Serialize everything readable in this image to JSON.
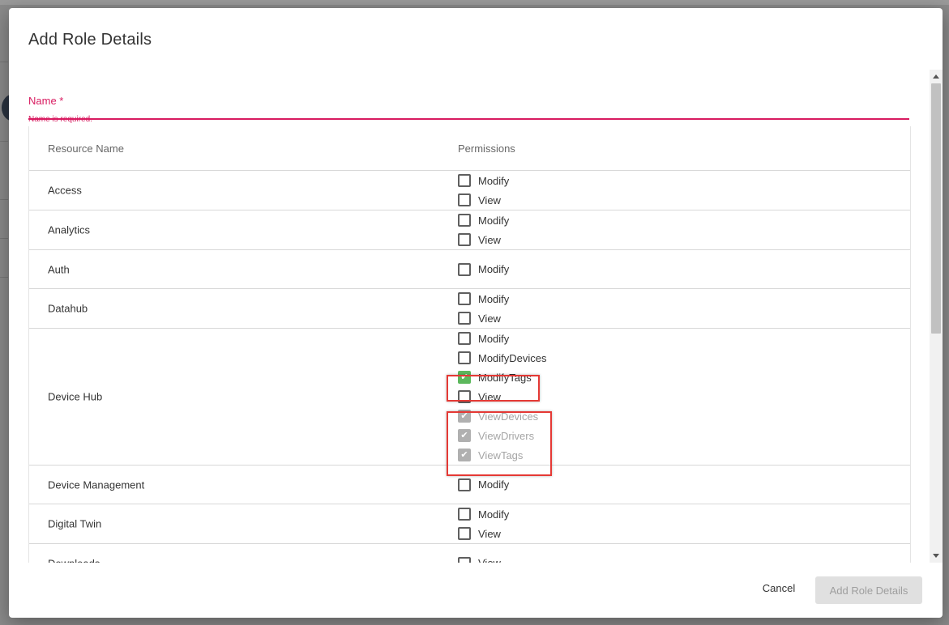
{
  "dialog": {
    "title": "Add Role Details",
    "name_field": {
      "label": "Name *",
      "value": "",
      "error": "Name is required."
    },
    "table": {
      "headers": [
        "Resource Name",
        "Permissions"
      ],
      "rows": [
        {
          "resource": "Access",
          "permissions": [
            {
              "label": "Modify",
              "state": "unchecked"
            },
            {
              "label": "View",
              "state": "unchecked"
            }
          ]
        },
        {
          "resource": "Analytics",
          "permissions": [
            {
              "label": "Modify",
              "state": "unchecked"
            },
            {
              "label": "View",
              "state": "unchecked"
            }
          ]
        },
        {
          "resource": "Auth",
          "permissions": [
            {
              "label": "Modify",
              "state": "unchecked"
            }
          ]
        },
        {
          "resource": "Datahub",
          "permissions": [
            {
              "label": "Modify",
              "state": "unchecked"
            },
            {
              "label": "View",
              "state": "unchecked"
            }
          ]
        },
        {
          "resource": "Device Hub",
          "permissions": [
            {
              "label": "Modify",
              "state": "unchecked"
            },
            {
              "label": "ModifyDevices",
              "state": "unchecked"
            },
            {
              "label": "ModifyTags",
              "state": "checked"
            },
            {
              "label": "View",
              "state": "unchecked"
            },
            {
              "label": "ViewDevices",
              "state": "checked-disabled"
            },
            {
              "label": "ViewDrivers",
              "state": "checked-disabled"
            },
            {
              "label": "ViewTags",
              "state": "checked-disabled"
            }
          ]
        },
        {
          "resource": "Device Management",
          "permissions": [
            {
              "label": "Modify",
              "state": "unchecked"
            }
          ]
        },
        {
          "resource": "Digital Twin",
          "permissions": [
            {
              "label": "Modify",
              "state": "unchecked"
            },
            {
              "label": "View",
              "state": "unchecked"
            }
          ]
        },
        {
          "resource": "Downloads",
          "permissions": [
            {
              "label": "View",
              "state": "unchecked"
            }
          ]
        }
      ]
    },
    "actions": {
      "cancel": "Cancel",
      "submit": "Add Role Details"
    }
  },
  "colors": {
    "error": "#d81b60",
    "checked": "#5cb85c",
    "disabled": "#b0b0b0",
    "highlight": "#e53935"
  }
}
